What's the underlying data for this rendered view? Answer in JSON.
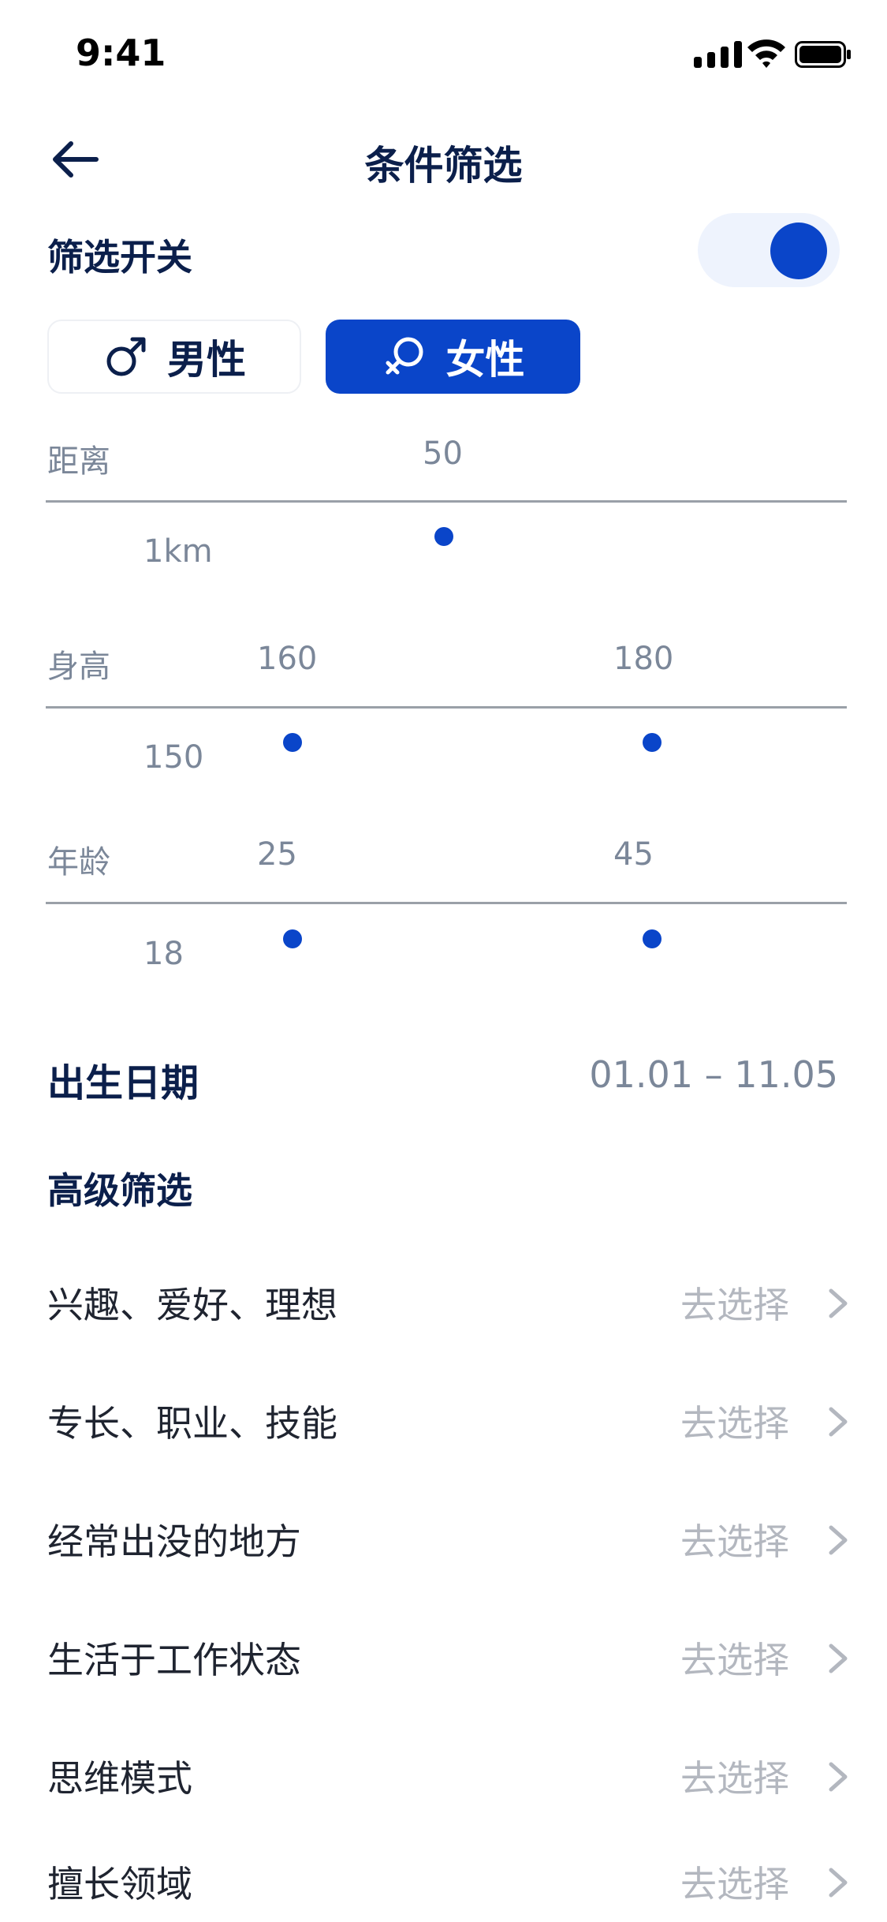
{
  "status_bar": {
    "time": "9:41"
  },
  "nav": {
    "title": "条件筛选"
  },
  "filter_switch": {
    "label": "筛选开关",
    "on": true
  },
  "gender": {
    "male": "男性",
    "female": "女性",
    "selected": "female"
  },
  "distance": {
    "label": "距离",
    "value": "50",
    "min": "1km"
  },
  "height": {
    "label": "身高",
    "low": "160",
    "high": "180",
    "min": "150"
  },
  "age": {
    "label": "年龄",
    "low": "25",
    "high": "45",
    "min": "18"
  },
  "birth_date": {
    "label": "出生日期",
    "range": "01.01 – 11.05"
  },
  "advanced": {
    "title": "高级筛选",
    "action": "去选择",
    "items": [
      {
        "label": "兴趣、爱好、理想"
      },
      {
        "label": "专长、职业、技能"
      },
      {
        "label": "经常出没的地方"
      },
      {
        "label": "生活于工作状态"
      },
      {
        "label": "思维模式"
      },
      {
        "label": "擅长领域"
      }
    ]
  },
  "colors": {
    "primary": "#0a45c9",
    "title": "#0b1f4b",
    "muted": "#7b8799",
    "action": "#b3b7bf"
  }
}
